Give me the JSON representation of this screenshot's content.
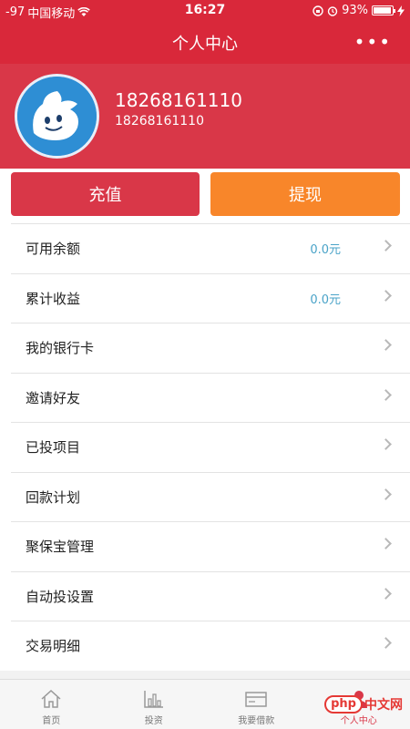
{
  "status_bar": {
    "signal": "-97",
    "carrier": "中国移动",
    "time": "16:27",
    "battery": "93%"
  },
  "header": {
    "title": "个人中心",
    "more": "•••"
  },
  "profile": {
    "name": "18268161110",
    "phone": "18268161110"
  },
  "actions": {
    "recharge": "充值",
    "withdraw": "提现"
  },
  "menu": [
    {
      "label": "可用余额",
      "value": "0.0元"
    },
    {
      "label": "累计收益",
      "value": "0.0元"
    },
    {
      "label": "我的银行卡",
      "value": ""
    },
    {
      "label": "邀请好友",
      "value": ""
    },
    {
      "label": "已投项目",
      "value": ""
    },
    {
      "label": "回款计划",
      "value": ""
    },
    {
      "label": "聚保宝管理",
      "value": ""
    },
    {
      "label": "自动投设置",
      "value": ""
    },
    {
      "label": "交易明细",
      "value": ""
    }
  ],
  "tabs": [
    {
      "label": "首页",
      "icon": "home-icon"
    },
    {
      "label": "投资",
      "icon": "chart-icon"
    },
    {
      "label": "我要借款",
      "icon": "card-icon"
    },
    {
      "label": "个人中心",
      "icon": "user-icon",
      "active": true
    }
  ],
  "watermark": {
    "php": "php",
    "cn": "中文网"
  },
  "colors": {
    "primary": "#d9283a",
    "profile_bg": "#d93748",
    "withdraw": "#f8862a",
    "value": "#4aa3c8"
  }
}
